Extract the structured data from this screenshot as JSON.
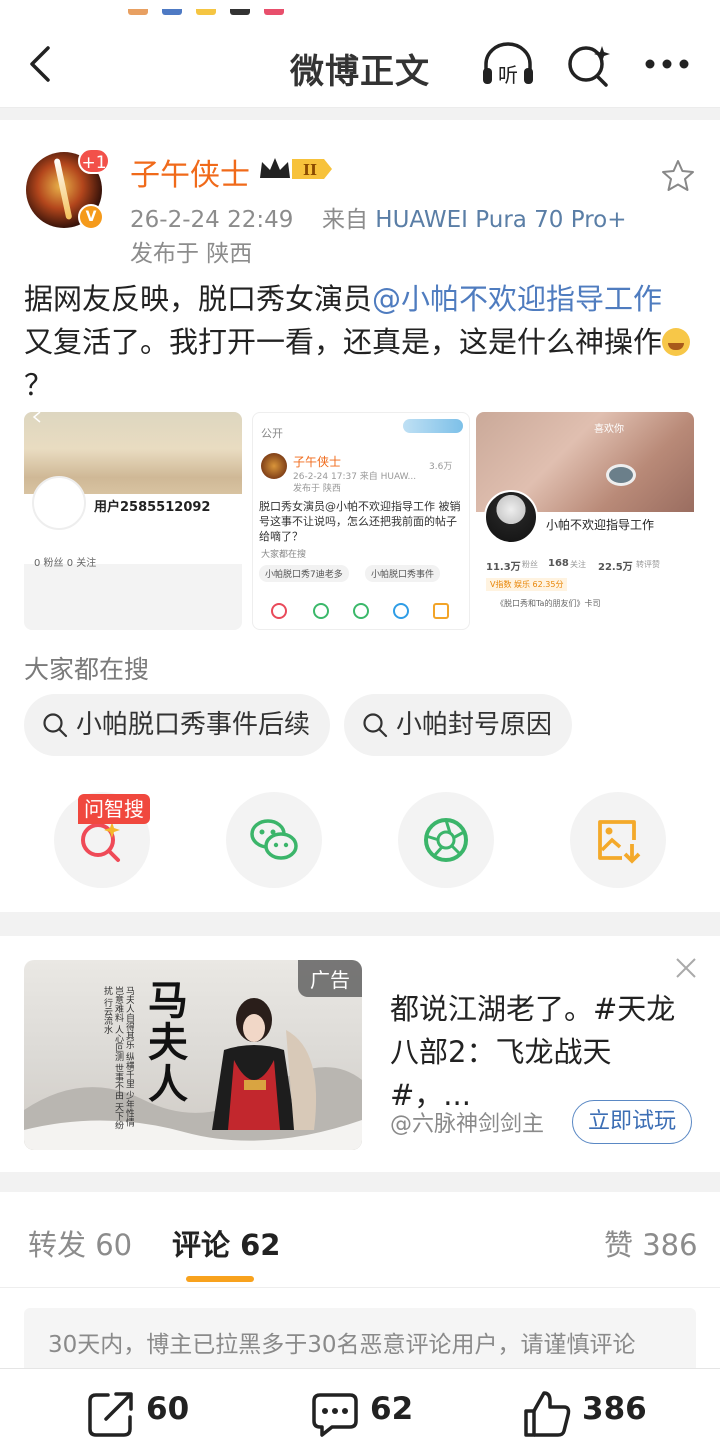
{
  "nav": {
    "title": "微博正文",
    "listen_label": "听"
  },
  "post": {
    "username": "子午侠士",
    "plus_badge": "+1",
    "level_badge": "II",
    "time": "26-2-24 22:49",
    "source_prefix": "来自",
    "source": "HUAWEI Pura 70 Pro+",
    "location": "发布于 陕西",
    "text_before": "据网友反映，脱口秀女演员",
    "mention": "@小帕不欢迎指导工作",
    "text_after": " 又复活了。我打开一看，还真是，这是什么神操作",
    "text_end": "？",
    "images": {
      "img1_user": "用户2585512092",
      "img1_stats": "0 粉丝    0 关注",
      "img2_public": "公开",
      "img2_user": "子午侠士",
      "img2_meta": "26-2-24 17:37  来自 HUAW...",
      "img2_loc": "发布于 陕西",
      "img2_views": "3.6万",
      "img2_text": "脱口秀女演员@小帕不欢迎指导工作 被销号这事不让说吗，怎么还把我前面的帖子给嘀了？",
      "img2_search": "大家都在搜",
      "img2_pill1": "小帕脱口秀7迪老多",
      "img2_pill2": "小帕脱口秀事件",
      "img3_top": "喜欢你",
      "img3_name": "小帕不欢迎指导工作",
      "img3_fans": "11.3万",
      "img3_follow": "168",
      "img3_likes": "22.5万",
      "img3_fans_l": "粉丝",
      "img3_follow_l": "关注",
      "img3_likes_l": "转评赞",
      "img3_v": "V指数 娱乐 62.35分",
      "img3_card": "《脱口秀和Ta的朋友们》卡司"
    },
    "search_heading": "大家都在搜",
    "search_pills": [
      "小帕脱口秀事件后续",
      "小帕封号原因"
    ],
    "wenzhisou_tag": "问智搜"
  },
  "ad": {
    "tag": "广告",
    "title": "都说江湖老了。#天龙八部2：飞龙战天#，...",
    "source": "@六脉神剑剑主",
    "button": "立即试玩",
    "image_title": "马夫人",
    "image_verse": "马夫人自得其乐 纵横千里 少年性情 岂意难料 人心叵测 世事不由 天下纷扰 行云流水"
  },
  "tabs": {
    "repost": "转发 60",
    "comment": "评论 62",
    "like": "赞 386"
  },
  "notice": {
    "text": "30天内，博主已拉黑多于30名恶意评论用户，请谨慎评论"
  },
  "bottom": {
    "repost_count": "60",
    "comment_count": "62",
    "like_count": "386"
  },
  "colors": {
    "username": "#f06a1a",
    "link": "#4f7cbf",
    "tab_underline": "#f8a21d"
  }
}
